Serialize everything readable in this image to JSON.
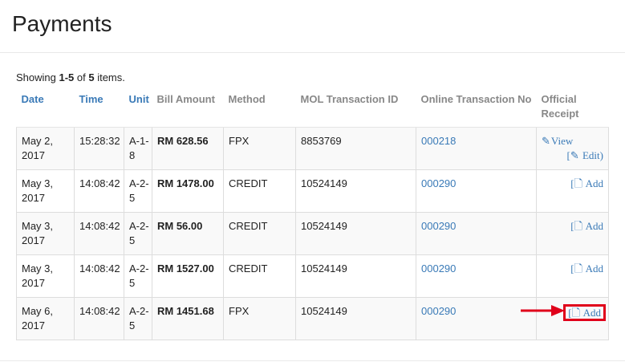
{
  "page": {
    "title": "Payments"
  },
  "summary": {
    "prefix": "Showing ",
    "range": "1-5",
    "middle": " of ",
    "total": "5",
    "suffix": " items."
  },
  "table": {
    "headers": {
      "date": "Date",
      "time": "Time",
      "unit": "Unit",
      "bill_amount": "Bill Amount",
      "method": "Method",
      "mol_transaction_id": "MOL Transaction ID",
      "online_transaction_no": "Online Transaction No",
      "official_receipt": "Official Receipt"
    },
    "rows": [
      {
        "date": "May 2, 2017",
        "time": "15:28:32",
        "unit": "A-1-8",
        "amount": "RM 628.56",
        "method": "FPX",
        "mol_id": "8853769",
        "online_no": "000218",
        "receipt_view": "View",
        "receipt_edit": "Edit"
      },
      {
        "date": "May 3, 2017",
        "time": "14:08:42",
        "unit": "A-2-5",
        "amount": "RM 1478.00",
        "method": "CREDIT",
        "mol_id": "10524149",
        "online_no": "000290",
        "receipt_add": "Add"
      },
      {
        "date": "May 3, 2017",
        "time": "14:08:42",
        "unit": "A-2-5",
        "amount": "RM 56.00",
        "method": "CREDIT",
        "mol_id": "10524149",
        "online_no": "000290",
        "receipt_add": "Add"
      },
      {
        "date": "May 3, 2017",
        "time": "14:08:42",
        "unit": "A-2-5",
        "amount": "RM 1527.00",
        "method": "CREDIT",
        "mol_id": "10524149",
        "online_no": "000290",
        "receipt_add": "Add"
      },
      {
        "date": "May 6, 2017",
        "time": "14:08:42",
        "unit": "A-2-5",
        "amount": "RM 1451.68",
        "method": "FPX",
        "mol_id": "10524149",
        "online_no": "000290",
        "receipt_add": "Add"
      }
    ]
  },
  "colors": {
    "link": "#3a7ab7",
    "highlight": "#e0001a"
  },
  "icons": {
    "view": "tag-icon",
    "edit": "edit-icon",
    "add": "file-icon",
    "pointer": "arrow-right-icon"
  }
}
